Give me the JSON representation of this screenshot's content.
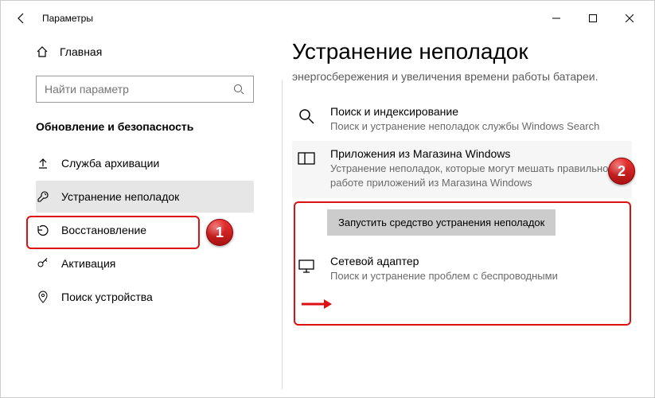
{
  "window": {
    "title": "Параметры"
  },
  "sidebar": {
    "home": "Главная",
    "search_placeholder": "Найти параметр",
    "category": "Обновление и безопасность",
    "items": [
      {
        "label": "Служба архивации"
      },
      {
        "label": "Устранение неполадок"
      },
      {
        "label": "Восстановление"
      },
      {
        "label": "Активация"
      },
      {
        "label": "Поиск устройства"
      }
    ]
  },
  "main": {
    "heading": "Устранение неполадок",
    "top_desc": "энергосбережения и увеличения  времени работы батареи.",
    "items": [
      {
        "title": "Поиск и индексирование",
        "desc": "Поиск и устранение неполадок службы Windows Search"
      },
      {
        "title": "Приложения из Магазина Windows",
        "desc": "Устранение неполадок, которые могут мешать правильной работе приложений из Магазина Windows"
      },
      {
        "title": "Сетевой адаптер",
        "desc": "Поиск и устранение проблем с беспроводными"
      }
    ],
    "run_button": "Запустить средство устранения неполадок"
  }
}
